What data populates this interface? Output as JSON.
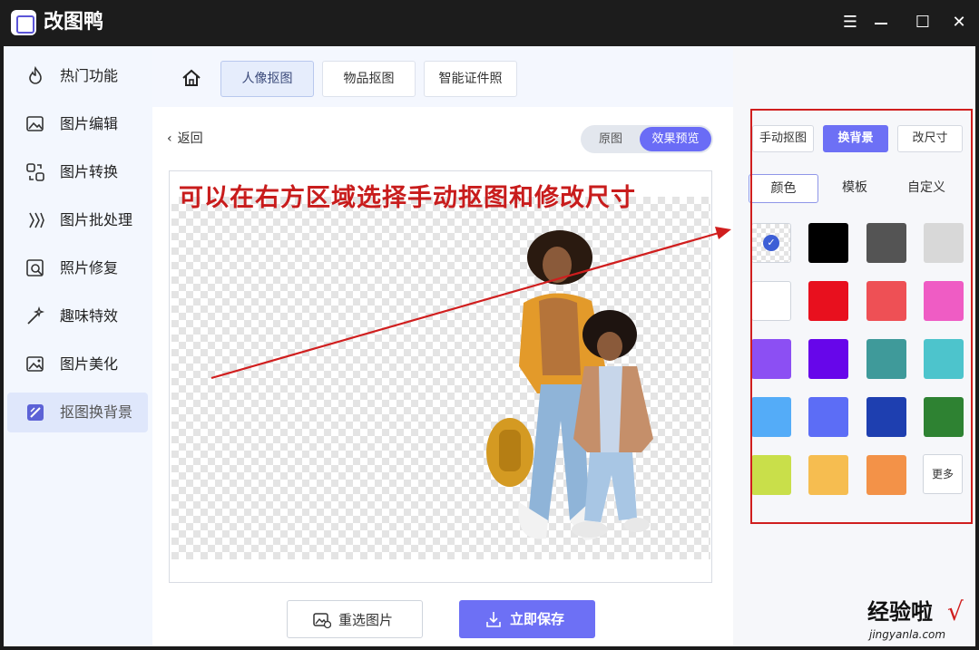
{
  "app": {
    "title": "改图鸭"
  },
  "window_controls": {
    "menu": "☰",
    "maximize": "☐",
    "close": "✕"
  },
  "sidebar": {
    "items": [
      {
        "label": "热门功能",
        "icon": "flame-icon"
      },
      {
        "label": "图片编辑",
        "icon": "image-edit-icon"
      },
      {
        "label": "图片转换",
        "icon": "convert-icon"
      },
      {
        "label": "图片批处理",
        "icon": "batch-icon"
      },
      {
        "label": "照片修复",
        "icon": "photo-repair-icon"
      },
      {
        "label": "趣味特效",
        "icon": "magic-wand-icon"
      },
      {
        "label": "图片美化",
        "icon": "beautify-icon"
      },
      {
        "label": "抠图换背景",
        "icon": "cutout-icon",
        "active": true
      }
    ]
  },
  "topnav": {
    "tabs": [
      {
        "label": "人像抠图",
        "active": true
      },
      {
        "label": "物品抠图"
      },
      {
        "label": "智能证件照"
      }
    ]
  },
  "editor": {
    "back_label": "返回",
    "view_toggle": {
      "original": "原图",
      "preview": "效果预览",
      "selected": "preview"
    },
    "overlay_annotation": "可以在右方区域选择手动抠图和修改尺寸",
    "reselect_label": "重选图片",
    "save_label": "立即保存"
  },
  "panel": {
    "modes": [
      {
        "label": "手动抠图"
      },
      {
        "label": "换背景",
        "active": true
      },
      {
        "label": "改尺寸"
      }
    ],
    "subtabs": [
      {
        "label": "颜色",
        "active": true
      },
      {
        "label": "模板"
      },
      {
        "label": "自定义"
      }
    ],
    "swatches": [
      {
        "name": "transparent",
        "color": "transparent",
        "selected": true
      },
      {
        "name": "black",
        "color": "#000000"
      },
      {
        "name": "dark-gray",
        "color": "#545454"
      },
      {
        "name": "light-gray",
        "color": "#d8d8d8"
      },
      {
        "name": "white",
        "color": "#ffffff"
      },
      {
        "name": "red",
        "color": "#e8101e"
      },
      {
        "name": "coral",
        "color": "#ee5055"
      },
      {
        "name": "pink",
        "color": "#ef5cc4"
      },
      {
        "name": "violet",
        "color": "#8c4ff3"
      },
      {
        "name": "purple",
        "color": "#6706ea"
      },
      {
        "name": "teal",
        "color": "#3f9a9a"
      },
      {
        "name": "aqua",
        "color": "#4dc4cc"
      },
      {
        "name": "sky-blue",
        "color": "#54acf8"
      },
      {
        "name": "periwinkle",
        "color": "#5c6df6"
      },
      {
        "name": "navy",
        "color": "#1e3fb0"
      },
      {
        "name": "green",
        "color": "#2e8232"
      },
      {
        "name": "lime",
        "color": "#c9df4a"
      },
      {
        "name": "amber",
        "color": "#f6bd50"
      },
      {
        "name": "orange",
        "color": "#f39248"
      }
    ],
    "more_label": "更多"
  },
  "watermark": {
    "main": "经验啦",
    "check": "√",
    "sub": "jingyanla.com"
  },
  "colors": {
    "accent": "#6d70f5",
    "annotation_red": "#d01e1e"
  }
}
